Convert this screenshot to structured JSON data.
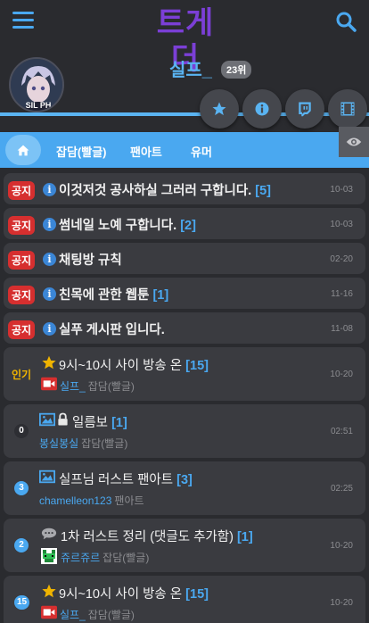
{
  "app": {
    "logo_text": "트게더",
    "accent": "#4aa8f0",
    "brand": "#7b3fd6"
  },
  "channel": {
    "name": "실프_",
    "rank": "23위",
    "avatar_text": "SIL PH"
  },
  "header_icons": [
    "menu-icon",
    "search-icon"
  ],
  "action_buttons": [
    "star-icon",
    "info-icon",
    "twitch-icon",
    "film-icon"
  ],
  "tabs": [
    {
      "label": "잡담(빨글)"
    },
    {
      "label": "팬아트"
    },
    {
      "label": "유머"
    }
  ],
  "notices": [
    {
      "badge": "공지",
      "title": "이것저것 공사하실 그러러 구합니다.",
      "count": "[5]",
      "date": "10-03"
    },
    {
      "badge": "공지",
      "title": "썸네일 노예 구합니다.",
      "count": "[2]",
      "date": "10-03"
    },
    {
      "badge": "공지",
      "title": "채팅방 규칙",
      "count": "",
      "date": "02-20"
    },
    {
      "badge": "공지",
      "title": "친목에 관한 웹툰",
      "count": "[1]",
      "date": "11-16"
    },
    {
      "badge": "공지",
      "title": "실푸 게시판 입니다.",
      "count": "",
      "date": "11-08"
    }
  ],
  "posts": [
    {
      "label": "인기",
      "title": "9시~10시 사이 방송 온",
      "count": "[15]",
      "author": "실프_",
      "category": "잡담(빨글)",
      "date": "10-20",
      "icon": "star-icon",
      "author_icon": "video-icon"
    },
    {
      "label": "0",
      "title": "일름보",
      "count": "[1]",
      "author": "봉실봉실",
      "category": "잡담(빨글)",
      "date": "02:51",
      "icon": "image-icon",
      "icon2": "lock-icon"
    },
    {
      "label": "3",
      "title": "실프님 러스트 팬아트",
      "count": "[3]",
      "author": "chamelleon123",
      "category": "팬아트",
      "date": "02:25",
      "icon": "image-icon"
    },
    {
      "label": "2",
      "title": "1차 러스트 정리 (댓글도 추가함)",
      "count": "[1]",
      "author": "쥬르쥬르",
      "category": "잡담(빨글)",
      "date": "10-20",
      "icon": "comment-icon",
      "author_icon": "pixel-avatar-icon"
    },
    {
      "label": "15",
      "title": "9시~10시 사이 방송 온",
      "count": "[15]",
      "author": "실프_",
      "category": "잡담(빨글)",
      "date": "10-20",
      "icon": "star-icon",
      "author_icon": "video-icon"
    }
  ]
}
